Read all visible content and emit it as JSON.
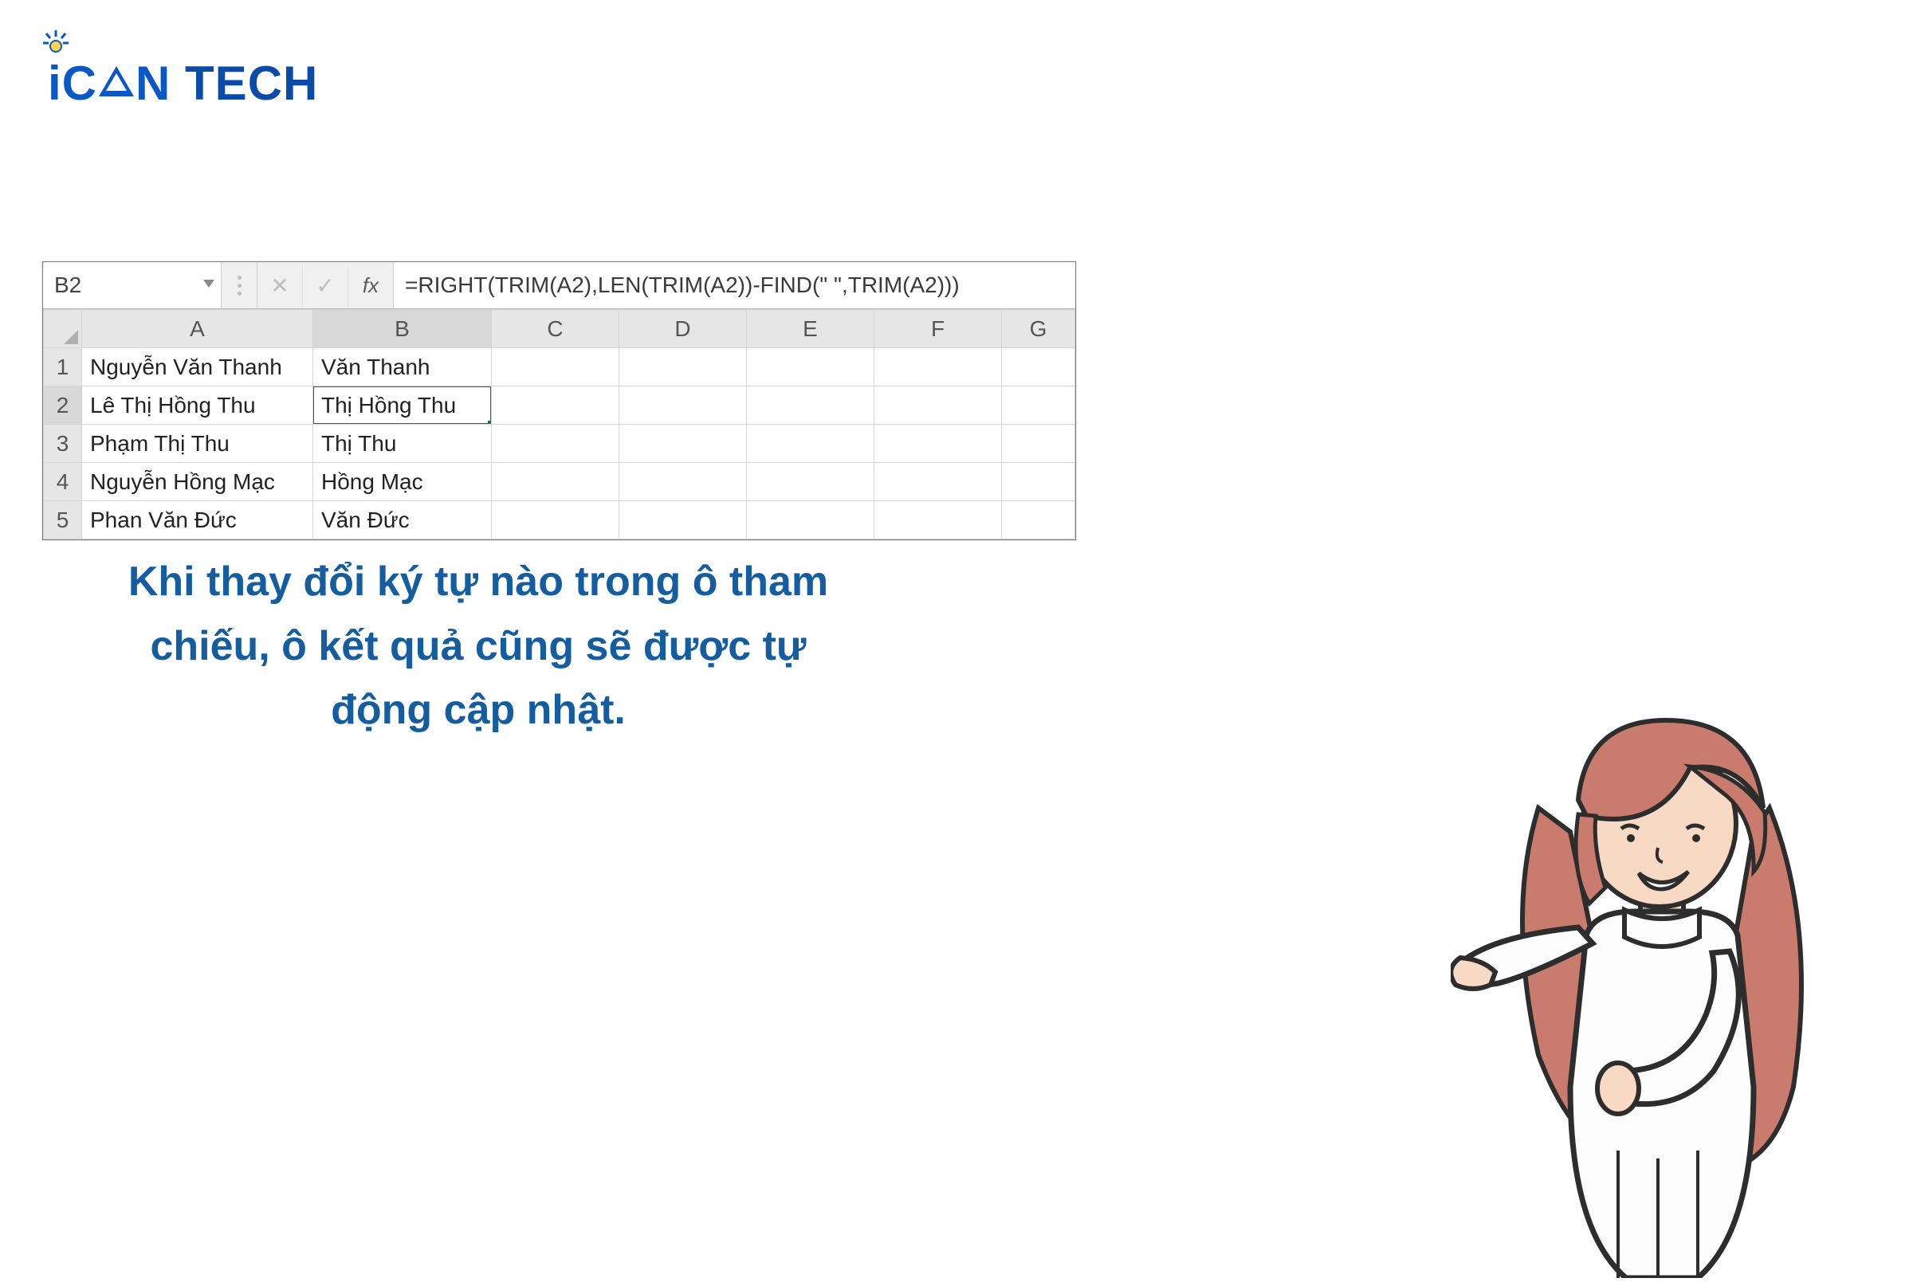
{
  "logo": {
    "brand_i": "i",
    "brand_can1": "C",
    "brand_can3": "N",
    "brand_tech": "TECH"
  },
  "formula_bar": {
    "name_box": "B2",
    "fx_label": "fx",
    "cancel": "✕",
    "confirm": "✓",
    "formula": "=RIGHT(TRIM(A2),LEN(TRIM(A2))-FIND(\" \",TRIM(A2)))"
  },
  "columns": [
    "A",
    "B",
    "C",
    "D",
    "E",
    "F",
    "G"
  ],
  "rows": [
    {
      "n": "1",
      "a": "Nguyễn Văn Thanh",
      "b": "Văn Thanh"
    },
    {
      "n": "2",
      "a": "Lê Thị Hồng Thu",
      "b": "Thị Hồng Thu"
    },
    {
      "n": "3",
      "a": "Phạm Thị Thu",
      "b": "Thị Thu"
    },
    {
      "n": "4",
      "a": "Nguyễn Hồng Mạc",
      "b": "Hồng Mạc"
    },
    {
      "n": "5",
      "a": "Phan Văn Đức",
      "b": "Văn Đức"
    }
  ],
  "caption": "Khi thay đổi ký tự nào trong ô tham chiếu, ô kết quả cũng sẽ được tự động cập nhật."
}
